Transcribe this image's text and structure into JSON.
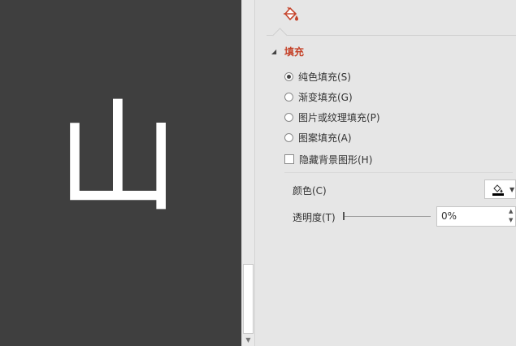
{
  "slide": {
    "glyph": "山",
    "background": "#3f3f3f",
    "glyph_color": "#ffffff"
  },
  "pane": {
    "tab_icon": "fill-bucket-icon",
    "section_title": "填充",
    "accent": "#c5432a",
    "fill_options": [
      {
        "label": "纯色填充(S)",
        "checked": true
      },
      {
        "label": "渐变填充(G)",
        "checked": false
      },
      {
        "label": "图片或纹理填充(P)",
        "checked": false
      },
      {
        "label": "图案填充(A)",
        "checked": false
      }
    ],
    "hide_background": {
      "label": "隐藏背景图形(H)",
      "checked": false
    },
    "color": {
      "label": "颜色(C)",
      "icon": "paint-bucket-icon",
      "value_color": "#000000"
    },
    "transparency": {
      "label": "透明度(T)",
      "value": "0%",
      "fraction": 0
    }
  }
}
